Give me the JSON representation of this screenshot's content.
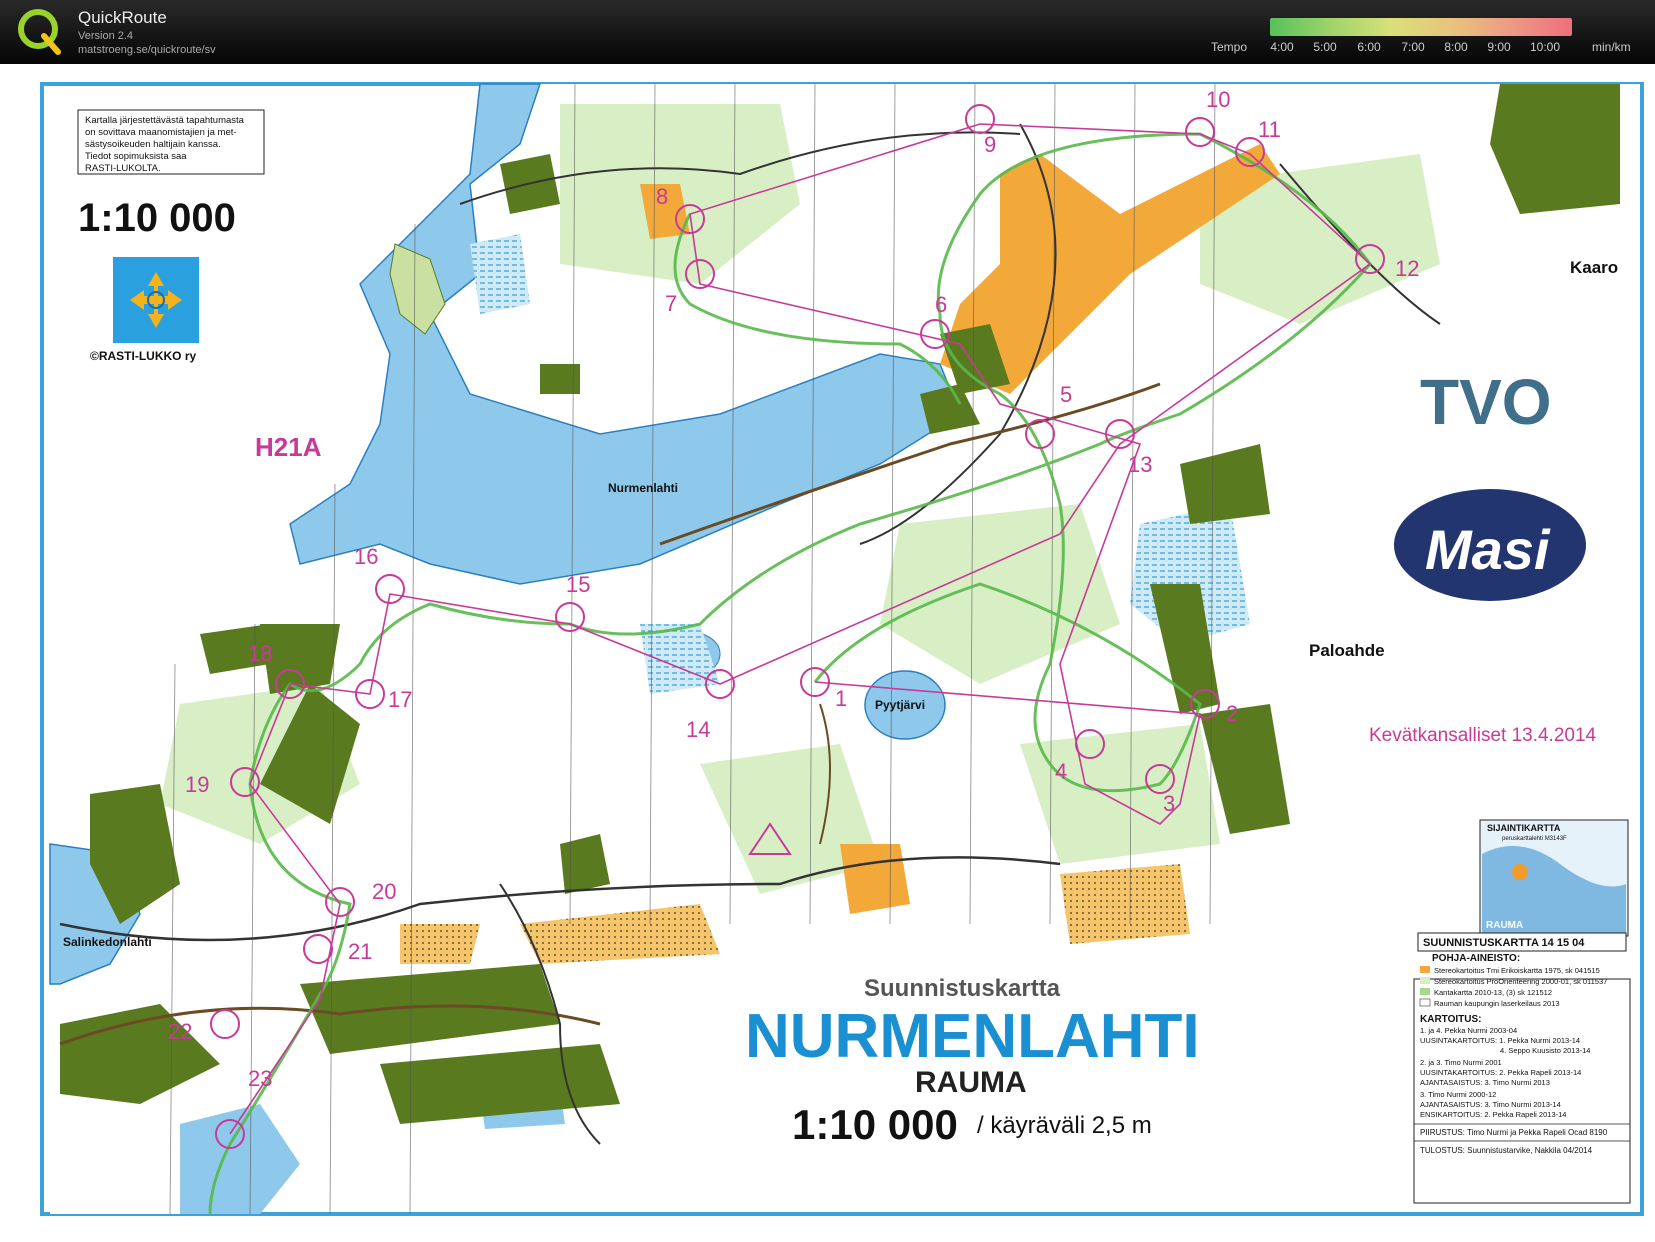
{
  "app": {
    "name": "QuickRoute",
    "version": "Version 2.4",
    "url": "matstroeng.se/quickroute/sv"
  },
  "tempo": {
    "label": "Tempo",
    "ticks": [
      "4:00",
      "5:00",
      "6:00",
      "7:00",
      "8:00",
      "9:00",
      "10:00"
    ],
    "unit": "min/km",
    "colors": [
      "#56c15b",
      "#d9e07a",
      "#ee6f7b"
    ]
  },
  "map": {
    "notice_lines": [
      "Kartalla järjestettävästä tapahtumasta",
      "on sovittava maanomistajien ja met-",
      "sästysoikeuden haltijain kanssa.",
      "Tiedot sopimuksista saa",
      "RASTI-LUKOLTA."
    ],
    "scale_top": "1:10 000",
    "club": "©RASTI-LUKKO ry",
    "class": "H21A",
    "places": {
      "nurmenlahti": "Nurmenlahti",
      "kaaro": "Kaaro",
      "paloahde": "Paloahde",
      "pyytjarvi": "Pyytjärvi",
      "salinkedonlahti": "Salinkedonlahti"
    },
    "sponsors": {
      "tvo": "TVO",
      "masi": "Masi"
    },
    "event": "Kevätkansalliset 13.4.2014",
    "controls": [
      "1",
      "2",
      "3",
      "4",
      "5",
      "6",
      "7",
      "8",
      "9",
      "10",
      "11",
      "12",
      "13",
      "14",
      "15",
      "16",
      "17",
      "18",
      "19",
      "20",
      "21",
      "22",
      "23"
    ],
    "title": {
      "kicker": "Suunnistuskartta",
      "name": "NURMENLAHTI",
      "city": "RAUMA",
      "scale": "1:10 000",
      "contour": "/ käyräväli 2,5 m"
    },
    "inset": {
      "title": "SIJAINTIKARTTA",
      "sub": "peruskarttalehti M3143F",
      "label": "RAUMA"
    },
    "info": {
      "header": "SUUNNISTUSKARTTA  14 15 04",
      "base_title": "POHJA-AINEISTO:",
      "base": [
        "Stereokartoitus Tmi Erikoiskartta 1975, sk 041515",
        "Stereokartoitus ProOrienteering 2000-01, sk 011537",
        "Kantakartta 2010-13, (3) sk 121512",
        "Rauman kaupungin laserkeilaus 2013"
      ],
      "mapping_title": "KARTOITUS:",
      "mapping": [
        "1. ja 4. Pekka Nurmi 2003-04",
        "UUSINTAKARTOITUS: 1. Pekka Nurmi 2013-14",
        "4. Seppo Kuusisto 2013-14",
        "2. ja 3. Timo Nurmi 2001",
        "UUSINTAKARTOITUS: 2. Pekka Rapeli 2013-14",
        "AJANTASAISTUS: 3. Timo Nurmi 2013",
        "3. Timo Nurmi 2000-12",
        "AJANTASAISTUS: 3. Timo Nurmi 2013-14",
        "ENSIKARTOITUS: 2. Pekka Rapeli 2013-14"
      ],
      "drawing": "PIIRUSTUS: Timo Nurmi ja Pekka Rapeli Ocad 8190",
      "printing": "TULOSTUS: Suunnistustarvike, Nakkila 04/2014"
    }
  }
}
